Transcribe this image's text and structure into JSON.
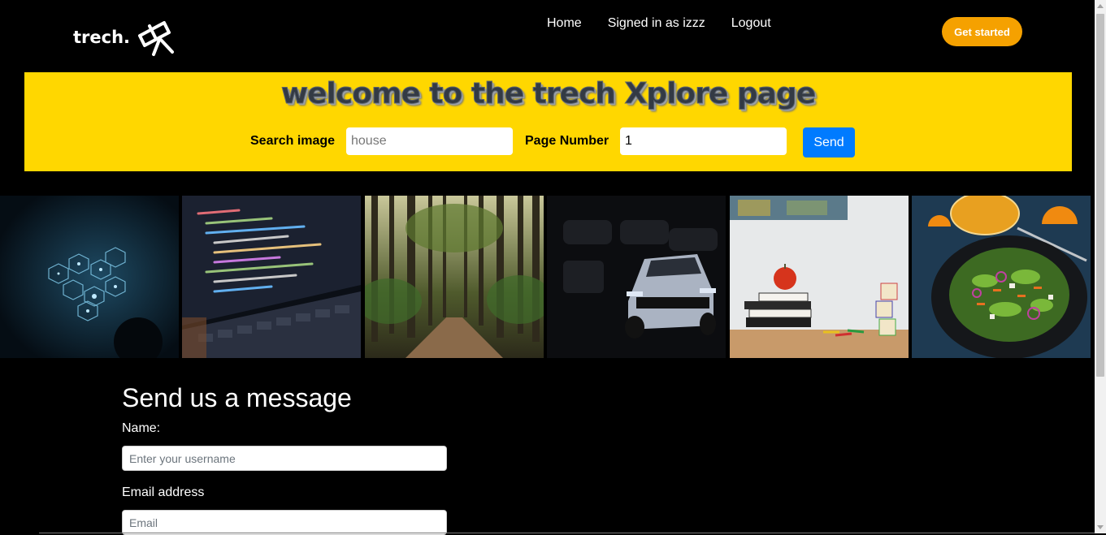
{
  "brand": {
    "name": "trech.",
    "logo": "telescope-icon"
  },
  "nav": {
    "items": [
      "Home",
      "Signed in as izzz",
      "Logout"
    ]
  },
  "cta": {
    "label": "Get started",
    "color": "#f5a100"
  },
  "banner": {
    "title": "welcome to the trech Xplore page",
    "background": "#ffd700",
    "search_label": "Search image",
    "search_placeholder": "house",
    "search_value": "",
    "page_label": "Page Number",
    "page_value": "1",
    "send_label": "Send",
    "send_color": "#007bff"
  },
  "gallery": {
    "images": [
      "network-cubes-image",
      "code-laptop-image",
      "forest-path-image",
      "sports-car-image",
      "apple-books-image",
      "salad-bowl-image"
    ]
  },
  "form": {
    "title": "Send us a message",
    "name_label": "Name:",
    "name_placeholder": "Enter your username",
    "email_label": "Email address",
    "email_placeholder": "Email"
  }
}
